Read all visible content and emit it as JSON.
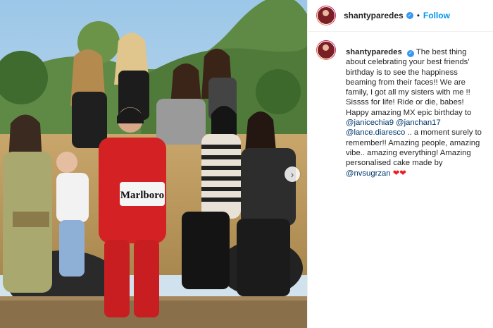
{
  "post": {
    "username": "shantyparedes",
    "follow_label": "Follow",
    "dot": "•",
    "caption": {
      "username": "shantyparedes",
      "text_1": "The best thing about celebrating your best friends' birthday is to see the happiness beaming from their faces!! We are family, I got all my sisters with me !! Sissss for life! Ride or die, babes! Happy amazing MX epic birthday to",
      "mention_1": "@janicechia9",
      "mention_2": "@janchan17",
      "mention_3": "@lance.diaresco",
      "text_2": ".. a moment surely to remember!! Amazing people, amazing vibe.. amazing everything! Amazing personalised cake made by",
      "mention_4": "@nvsugrzan",
      "hearts": "❤❤"
    },
    "photo": {
      "suit_text": "Marlboro",
      "carousel_next": "›"
    }
  },
  "colors": {
    "link": "#00376b",
    "follow": "#0095f6",
    "verified": "#3897f0"
  }
}
